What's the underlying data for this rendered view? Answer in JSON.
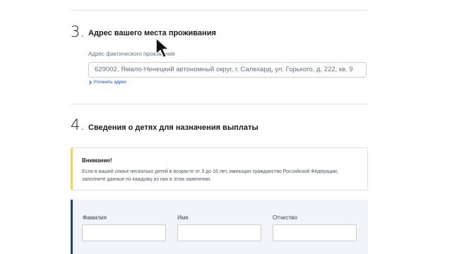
{
  "section3": {
    "number": "3.",
    "title": "Адрес вашего места проживания",
    "address_label": "Адрес фактического проживания",
    "address_value": "629002, Ямало-Ненецкий автономный округ, г. Салехард, ул. Горького, д. 222, кв. 9",
    "clarify_link": "Уточнить адрес"
  },
  "section4": {
    "number": "4.",
    "title": "Сведения о детях для назначения выплаты",
    "notice": {
      "title": "Внимание!",
      "text": "Если в вашей семье несколько детей в возрасте от 3 до 16 лет, имеющих гражданство Российской Федерации, заполните данные по каждому из них в этом заявлении."
    },
    "child_form": {
      "surname_label": "Фамилия",
      "name_label": "Имя",
      "patronymic_label": "Отчество"
    }
  },
  "colors": {
    "link": "#0d4cd3",
    "notice_accent": "#f0d94a",
    "panel_accent": "#1d3f8c",
    "panel_bg": "#f3f3fa"
  },
  "icons": {
    "cursor": "mouse-pointer-icon",
    "clarify": "chevron-right-icon"
  }
}
